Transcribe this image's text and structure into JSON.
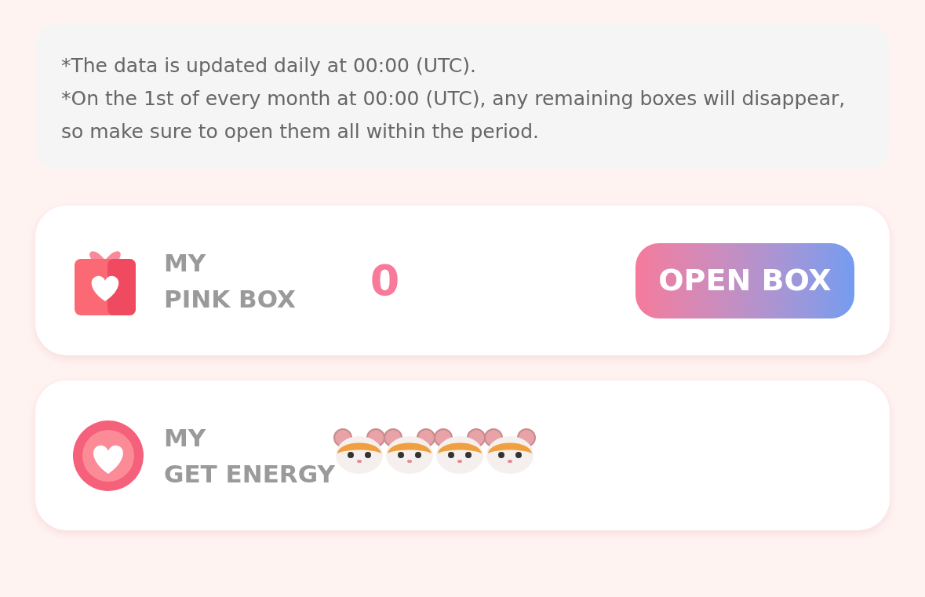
{
  "notice": {
    "lines": [
      "*The data is updated daily at 00:00 (UTC).",
      "*On the 1st of every month at 00:00 (UTC), any remaining boxes will disappear, so make sure to open them all within the period."
    ]
  },
  "cards": [
    {
      "kind": "box",
      "label_top": "MY",
      "label_bottom": "PINK BOX",
      "value": "0",
      "button": "OPEN BOX"
    },
    {
      "kind": "energy",
      "label_top": "MY",
      "label_bottom": "GET ENERGY",
      "stickers": [
        {
          "kind": "hamster"
        },
        {
          "kind": "hamster"
        },
        {
          "kind": "hamster"
        },
        {
          "kind": "hamster"
        }
      ]
    }
  ]
}
